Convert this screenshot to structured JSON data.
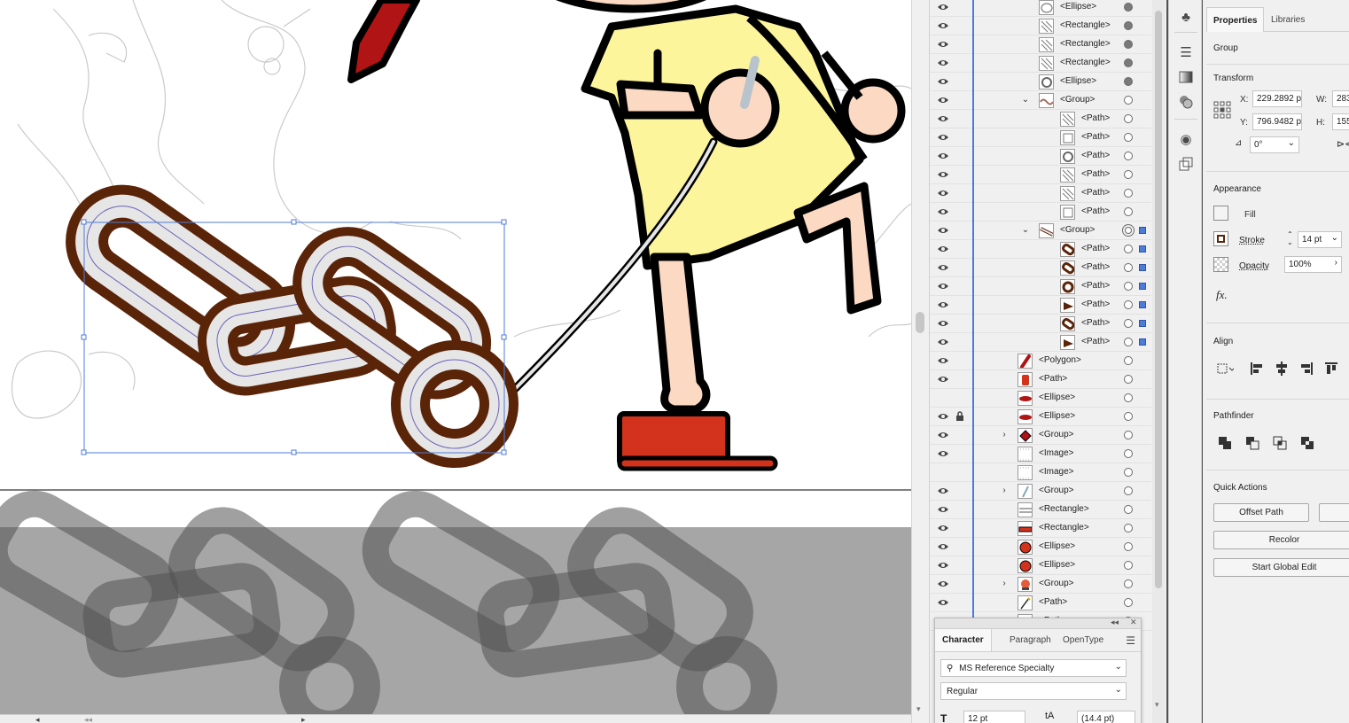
{
  "layers": {
    "rows": [
      {
        "name": "<Ellipse>",
        "level": 2,
        "eye": true,
        "target": "filled",
        "thumb": "ellipse"
      },
      {
        "name": "<Rectangle>",
        "level": 2,
        "eye": true,
        "target": "filled",
        "thumb": "diag"
      },
      {
        "name": "<Rectangle>",
        "level": 2,
        "eye": true,
        "target": "filled",
        "thumb": "diag"
      },
      {
        "name": "<Rectangle>",
        "level": 2,
        "eye": true,
        "target": "filled",
        "thumb": "diag"
      },
      {
        "name": "<Ellipse>",
        "level": 2,
        "eye": true,
        "target": "filled",
        "thumb": "ring"
      },
      {
        "name": "<Group>",
        "level": 2,
        "eye": true,
        "target": "empty",
        "expander": "open",
        "thumb": "squiggle"
      },
      {
        "name": "<Path>",
        "level": 3,
        "eye": true,
        "target": "empty",
        "thumb": "diag"
      },
      {
        "name": "<Path>",
        "level": 3,
        "eye": true,
        "target": "empty",
        "thumb": "rect"
      },
      {
        "name": "<Path>",
        "level": 3,
        "eye": true,
        "target": "empty",
        "thumb": "ring"
      },
      {
        "name": "<Path>",
        "level": 3,
        "eye": true,
        "target": "empty",
        "thumb": "diag"
      },
      {
        "name": "<Path>",
        "level": 3,
        "eye": true,
        "target": "empty",
        "thumb": "diag"
      },
      {
        "name": "<Path>",
        "level": 3,
        "eye": true,
        "target": "empty",
        "thumb": "rect"
      },
      {
        "name": "<Group>",
        "level": 2,
        "eye": true,
        "target": "double",
        "selected": true,
        "expander": "open",
        "thumb": "chain"
      },
      {
        "name": "<Path>",
        "level": 3,
        "eye": true,
        "target": "empty",
        "selected": true,
        "thumb": "brown-link"
      },
      {
        "name": "<Path>",
        "level": 3,
        "eye": true,
        "target": "empty",
        "selected": true,
        "thumb": "brown-link"
      },
      {
        "name": "<Path>",
        "level": 3,
        "eye": true,
        "target": "empty",
        "selected": true,
        "thumb": "brown-ring"
      },
      {
        "name": "<Path>",
        "level": 3,
        "eye": true,
        "target": "empty",
        "selected": true,
        "thumb": "brown-tri"
      },
      {
        "name": "<Path>",
        "level": 3,
        "eye": true,
        "target": "empty",
        "selected": true,
        "thumb": "brown-link"
      },
      {
        "name": "<Path>",
        "level": 3,
        "eye": true,
        "target": "empty",
        "selected": true,
        "thumb": "brown-tri"
      },
      {
        "name": "<Polygon>",
        "level": 1,
        "eye": true,
        "target": "empty",
        "thumb": "red-feather"
      },
      {
        "name": "<Path>",
        "level": 1,
        "eye": true,
        "target": "empty",
        "thumb": "red-rect"
      },
      {
        "name": "<Ellipse>",
        "level": 1,
        "eye": false,
        "target": "empty",
        "thumb": "red-ellipse"
      },
      {
        "name": "<Ellipse>",
        "level": 1,
        "eye": true,
        "lock": true,
        "target": "empty",
        "thumb": "red-ellipse"
      },
      {
        "name": "<Group>",
        "level": 1,
        "eye": true,
        "target": "empty",
        "expander": "closed",
        "thumb": "red-diamond"
      },
      {
        "name": "<Image>",
        "level": 1,
        "eye": true,
        "target": "empty",
        "thumb": "dots"
      },
      {
        "name": "<Image>",
        "level": 1,
        "eye": false,
        "target": "empty",
        "thumb": "dots"
      },
      {
        "name": "<Group>",
        "level": 1,
        "eye": true,
        "target": "empty",
        "expander": "closed",
        "thumb": "slash"
      },
      {
        "name": "<Rectangle>",
        "level": 1,
        "eye": true,
        "target": "empty",
        "thumb": "hline"
      },
      {
        "name": "<Rectangle>",
        "level": 1,
        "eye": true,
        "target": "empty",
        "thumb": "red-bar"
      },
      {
        "name": "<Ellipse>",
        "level": 1,
        "eye": true,
        "target": "empty",
        "thumb": "red-circle"
      },
      {
        "name": "<Ellipse>",
        "level": 1,
        "eye": true,
        "target": "empty",
        "thumb": "red-circle"
      },
      {
        "name": "<Group>",
        "level": 1,
        "eye": true,
        "target": "empty",
        "expander": "closed",
        "thumb": "face"
      },
      {
        "name": "<Path>",
        "level": 1,
        "eye": true,
        "target": "empty",
        "thumb": "pencil"
      },
      {
        "name": "<Path>",
        "level": 1,
        "eye": true,
        "target": "empty",
        "thumb": "wave"
      }
    ]
  },
  "character": {
    "tabs": [
      "Character",
      "Paragraph",
      "OpenType"
    ],
    "font_family": "MS Reference Specialty",
    "font_style": "Regular",
    "font_size": "12 pt",
    "leading": "(14.4 pt)"
  },
  "properties": {
    "tabs": [
      "Properties",
      "Libraries"
    ],
    "selection_type": "Group",
    "transform": {
      "title": "Transform",
      "x_label": "X:",
      "x_value": "229.2892 p",
      "y_label": "Y:",
      "y_value": "796.9482 p",
      "w_label": "W:",
      "w_value": "283",
      "h_label": "H:",
      "h_value": "155",
      "angle_value": "0°"
    },
    "appearance": {
      "title": "Appearance",
      "fill_label": "Fill",
      "stroke_label": "Stroke",
      "stroke_value": "14 pt",
      "opacity_label": "Opacity",
      "opacity_value": "100%",
      "fx_label": "fx."
    },
    "align_title": "Align",
    "pathfinder_title": "Pathfinder",
    "quick_actions": {
      "title": "Quick Actions",
      "offset_path": "Offset Path",
      "recolor": "Recolor",
      "global_edit": "Start Global Edit"
    }
  },
  "colors": {
    "chain_outline": "#5a2408",
    "chain_link": "#e6e6e6",
    "shirt": "#fdf59c",
    "skin": "#fbd9c3",
    "shoe": "#d3321c",
    "tie": "#b01414",
    "selection": "#4f7bd8",
    "grey_band": "#a6a6a6"
  }
}
